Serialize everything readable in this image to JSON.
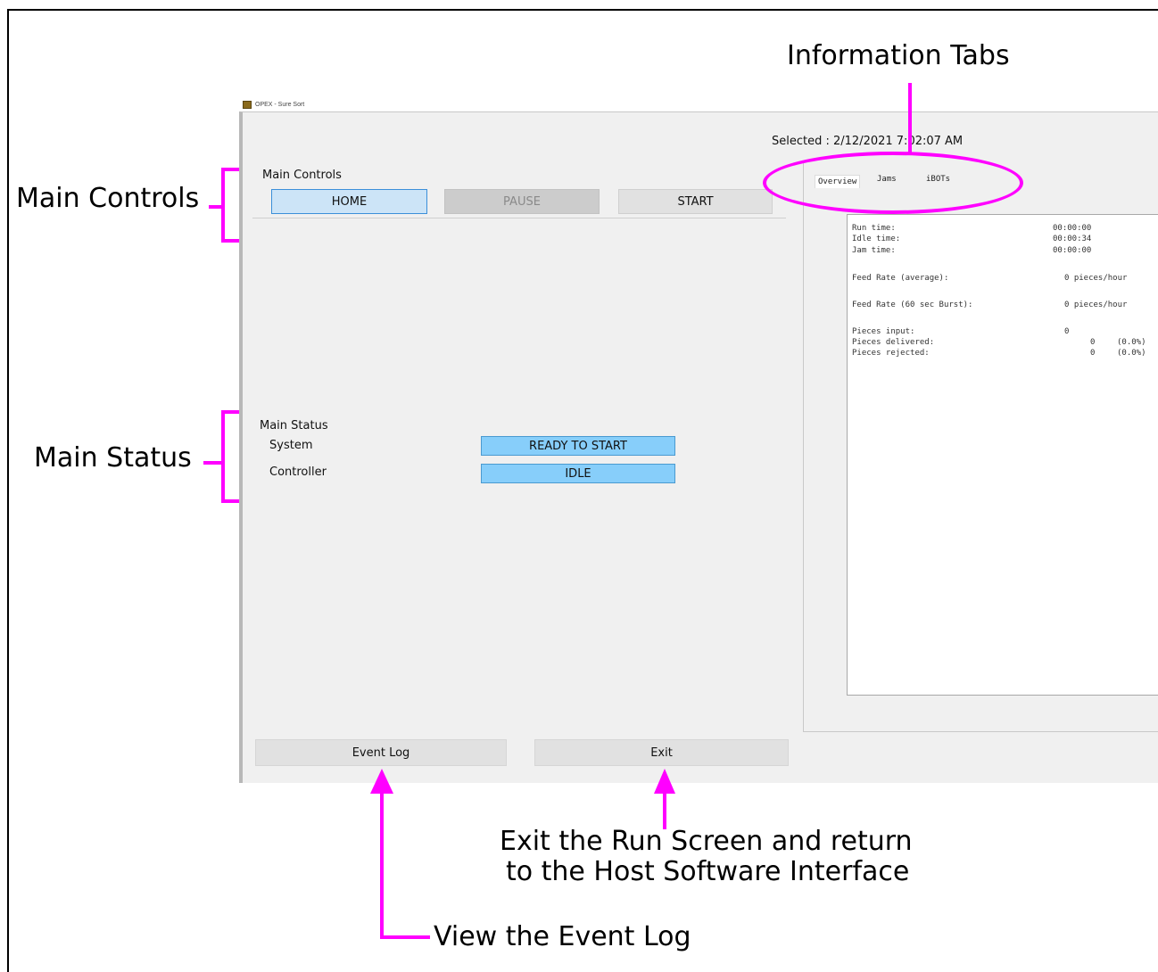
{
  "window": {
    "title": "OPEX - Sure Sort",
    "selected": "Selected : 2/12/2021 7:02:07 AM"
  },
  "main_controls": {
    "label": "Main Controls",
    "home": "HOME",
    "pause": "PAUSE",
    "start": "START"
  },
  "main_status": {
    "label": "Main Status",
    "system_label": "System",
    "system_value": "READY TO START",
    "controller_label": "Controller",
    "controller_value": "IDLE"
  },
  "tabs": [
    "Overview",
    "Jams",
    "iBOTs"
  ],
  "overview": {
    "rows": [
      {
        "label": "Run time:",
        "value": "00:00:00",
        "pct": ""
      },
      {
        "label": "Idle time:",
        "value": "00:00:34",
        "pct": ""
      },
      {
        "label": "Jam time:",
        "value": "00:00:00",
        "pct": ""
      },
      {
        "label": "Feed Rate (average):",
        "value": "0 pieces/hour",
        "pct": ""
      },
      {
        "label": "Feed Rate (60 sec Burst):",
        "value": "0 pieces/hour",
        "pct": ""
      },
      {
        "label": "Pieces input:",
        "value": "0",
        "pct": ""
      },
      {
        "label": "Pieces delivered:",
        "value": "0",
        "pct": "(0.0%)"
      },
      {
        "label": "Pieces rejected:",
        "value": "0",
        "pct": "(0.0%)"
      }
    ]
  },
  "footer": {
    "event_log": "Event Log",
    "exit": "Exit"
  },
  "callouts": {
    "information_tabs": "Information Tabs",
    "main_controls": "Main Controls",
    "main_status": "Main Status",
    "exit_line1": "Exit the Run Screen and return",
    "exit_line2": "to the Host Software Interface",
    "view_event_log": "View the Event Log"
  },
  "colors": {
    "annotation": "#ff00ff",
    "status_field": "#87cefa",
    "home_button": "#cce4f7"
  }
}
